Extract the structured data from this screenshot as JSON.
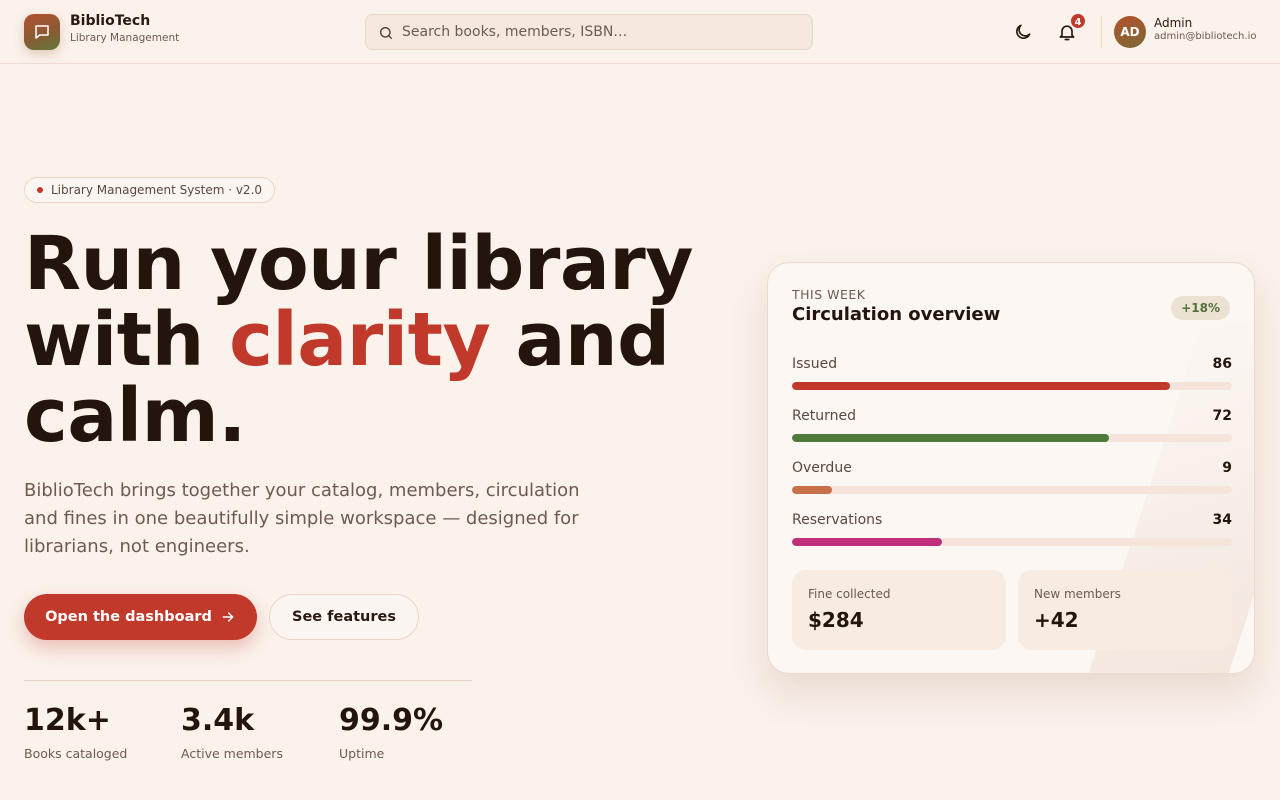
{
  "brand": {
    "name": "BiblioTech",
    "subtitle": "Library Management"
  },
  "search": {
    "placeholder": "Search books, members, ISBN…",
    "value": ""
  },
  "header": {
    "notifications_count": "4",
    "user_initials": "AD",
    "user_name": "Admin",
    "user_email": "admin@bibliotech.io"
  },
  "hero": {
    "tag": "Library Management System · v2.0",
    "headline_part1": "Run your library",
    "headline_part2": "with",
    "headline_accent": "clarity",
    "headline_part3": "and",
    "headline_part4": "calm.",
    "description": "BiblioTech brings together your catalog, members, circulation and fines in one beautifully simple workspace — designed for librarians, not engineers.",
    "primary_cta": "Open the dashboard",
    "secondary_cta": "See features"
  },
  "stats": [
    {
      "value": "12k+",
      "label": "Books cataloged"
    },
    {
      "value": "3.4k",
      "label": "Active members"
    },
    {
      "value": "99.9%",
      "label": "Uptime"
    }
  ],
  "card": {
    "eyebrow": "THIS WEEK",
    "title": "Circulation overview",
    "trend": "+18%",
    "metrics": [
      {
        "label": "Issued",
        "value": "86",
        "fill": 0.86,
        "color": "#c0392b"
      },
      {
        "label": "Returned",
        "value": "72",
        "fill": 0.72,
        "color": "#4e7a3c"
      },
      {
        "label": "Overdue",
        "value": "9",
        "fill": 0.09,
        "color": "#c8704a"
      },
      {
        "label": "Reservations",
        "value": "34",
        "fill": 0.34,
        "color": "#c0307a"
      }
    ],
    "fine_label": "Fine collected",
    "fine_value": "$284",
    "members_label": "New members",
    "members_value": "+42"
  },
  "icons": {
    "logo": "chat-bubble-icon",
    "search": "search-icon",
    "theme": "moon-icon",
    "notifications": "bell-icon",
    "cta_arrow": "arrow-right-icon"
  },
  "colors": {
    "accent": "#c0392b",
    "background": "#fbf2ec",
    "text": "#24140e",
    "muted": "#6e5a52"
  }
}
